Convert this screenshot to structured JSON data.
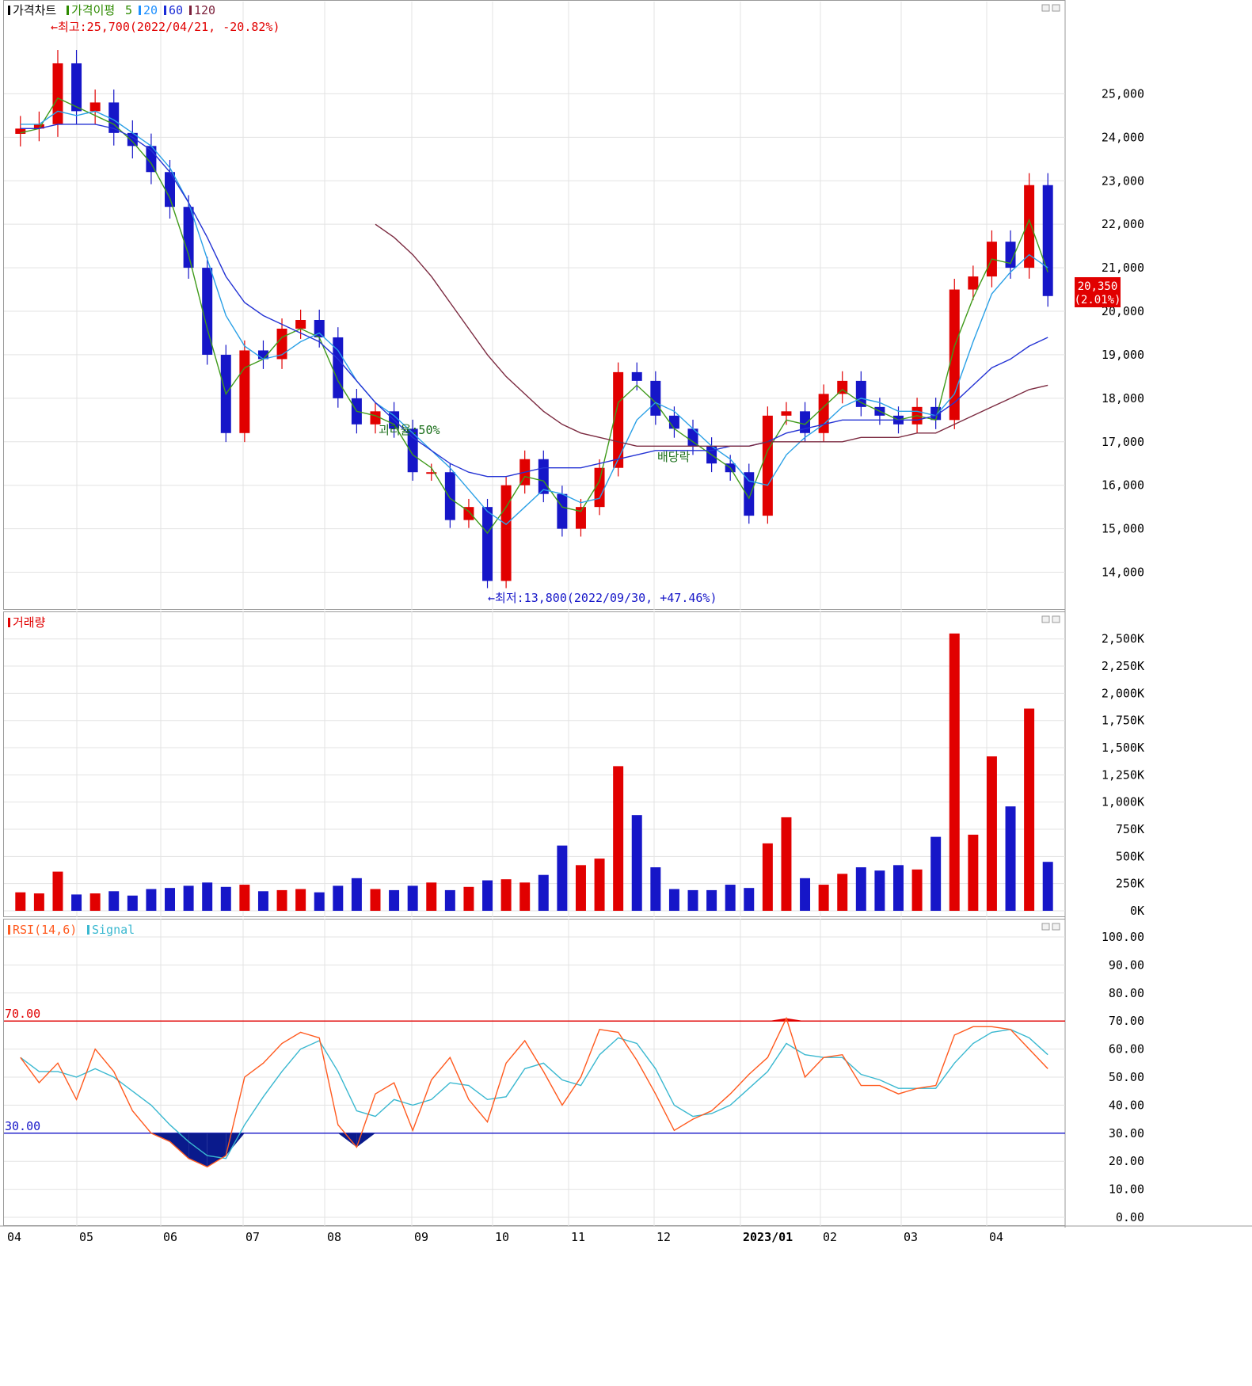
{
  "price_panel": {
    "legend": [
      {
        "text": "가격차트",
        "color": "#000000"
      },
      {
        "text": "가격이평",
        "color": "#2e8b00"
      },
      {
        "text": "5",
        "color": "#2e8b00"
      },
      {
        "text": "20",
        "color": "#1e90ff"
      },
      {
        "text": "60",
        "color": "#1a2bd6"
      },
      {
        "text": "120",
        "color": "#7b1f3a"
      }
    ],
    "high_annotation": "←최고:25,700(2022/04/21, -20.82%)",
    "low_annotation": "←최저:13,800(2022/09/30, +47.46%)",
    "marker_1": "괴리율:50%",
    "marker_2": "배당락",
    "last_price": "20,350",
    "last_change": "(2.01%)",
    "y_ticks": [
      "25,000",
      "24,000",
      "23,000",
      "22,000",
      "21,000",
      "20,000",
      "19,000",
      "18,000",
      "17,000",
      "16,000",
      "15,000",
      "14,000"
    ]
  },
  "volume_panel": {
    "title": "거래량",
    "y_ticks": [
      "2,500K",
      "2,250K",
      "2,000K",
      "1,750K",
      "1,500K",
      "1,250K",
      "1,000K",
      "750K",
      "500K",
      "250K",
      "0K"
    ]
  },
  "rsi_panel": {
    "title": "RSI(14,6)",
    "signal_label": "Signal",
    "level_70": "70.00",
    "level_30": "30.00",
    "y_ticks": [
      "100.00",
      "90.00",
      "80.00",
      "70.00",
      "60.00",
      "50.00",
      "40.00",
      "30.00",
      "20.00",
      "10.00",
      "0.00"
    ]
  },
  "x_axis_labels": [
    "04",
    "05",
    "06",
    "07",
    "08",
    "09",
    "10",
    "11",
    "12",
    "2023/01",
    "02",
    "03",
    "04"
  ],
  "colors": {
    "up": "#e10000",
    "down": "#1616c8",
    "ma5": "#3f9a1a",
    "ma20": "#2aa0e6",
    "ma60": "#2433d4",
    "ma120": "#7b2a40",
    "rsi": "#ff5a1f",
    "signal": "#3ab8d0"
  },
  "chart_data": {
    "type": "line",
    "title": "가격차트",
    "x": [
      "2022/04/08",
      "2022/04/15",
      "2022/04/21",
      "2022/04/29",
      "2022/05/06",
      "2022/05/13",
      "2022/05/20",
      "2022/05/27",
      "2022/06/03",
      "2022/06/10",
      "2022/06/17",
      "2022/06/24",
      "2022/07/01",
      "2022/07/08",
      "2022/07/15",
      "2022/07/22",
      "2022/07/29",
      "2022/08/05",
      "2022/08/12",
      "2022/08/19",
      "2022/08/26",
      "2022/09/02",
      "2022/09/09",
      "2022/09/16",
      "2022/09/23",
      "2022/09/30",
      "2022/10/07",
      "2022/10/14",
      "2022/10/21",
      "2022/10/28",
      "2022/11/04",
      "2022/11/11",
      "2022/11/18",
      "2022/11/25",
      "2022/12/02",
      "2022/12/09",
      "2022/12/16",
      "2022/12/23",
      "2022/12/30",
      "2023/01/06",
      "2023/01/13",
      "2023/01/20",
      "2023/01/27",
      "2023/02/03",
      "2023/02/10",
      "2023/02/17",
      "2023/02/24",
      "2023/03/03",
      "2023/03/10",
      "2023/03/17",
      "2023/03/24",
      "2023/03/31",
      "2023/04/07",
      "2023/04/14",
      "2023/04/21",
      "2023/04/28"
    ],
    "series": [
      {
        "name": "가격차트",
        "values": [
          24200,
          24300,
          25700,
          24600,
          24800,
          24100,
          23800,
          23200,
          22400,
          21000,
          19000,
          17200,
          19100,
          18900,
          19600,
          19800,
          19400,
          18000,
          17400,
          17700,
          17300,
          16300,
          16300,
          15200,
          15500,
          13800,
          16000,
          16600,
          15800,
          15000,
          15500,
          16400,
          18600,
          18400,
          17600,
          17300,
          16900,
          16500,
          16300,
          15300,
          17600,
          17700,
          17200,
          18100,
          18400,
          17800,
          17600,
          17400,
          17800,
          17500,
          20500,
          20800,
          21600,
          21000,
          22900,
          20350
        ]
      },
      {
        "name": "5",
        "values": [
          24100,
          24200,
          24900,
          24700,
          24500,
          24300,
          23900,
          23400,
          22600,
          21300,
          19600,
          18100,
          18700,
          18900,
          19400,
          19600,
          19400,
          18400,
          17700,
          17600,
          17400,
          16700,
          16400,
          15700,
          15400,
          14900,
          15500,
          16200,
          16100,
          15500,
          15400,
          16100,
          17900,
          18300,
          17900,
          17300,
          17000,
          16700,
          16400,
          15700,
          16800,
          17500,
          17400,
          17800,
          18200,
          17900,
          17700,
          17500,
          17600,
          17500,
          19200,
          20300,
          21200,
          21100,
          22100,
          20900
        ]
      },
      {
        "name": "20",
        "values": [
          24300,
          24300,
          24600,
          24500,
          24600,
          24400,
          24100,
          23800,
          23300,
          22500,
          21200,
          19900,
          19200,
          18900,
          19000,
          19300,
          19500,
          19100,
          18400,
          17900,
          17600,
          17200,
          16800,
          16400,
          15900,
          15400,
          15100,
          15500,
          15900,
          15800,
          15600,
          15700,
          16600,
          17500,
          17900,
          17700,
          17300,
          16900,
          16600,
          16100,
          16000,
          16700,
          17100,
          17400,
          17800,
          18000,
          17900,
          17700,
          17700,
          17600,
          18100,
          19300,
          20400,
          20900,
          21300,
          21000
        ]
      },
      {
        "name": "60",
        "values": [
          24200,
          24200,
          24300,
          24300,
          24300,
          24200,
          24000,
          23700,
          23200,
          22500,
          21700,
          20800,
          20200,
          19900,
          19700,
          19500,
          19300,
          18900,
          18400,
          17900,
          17500,
          17100,
          16800,
          16500,
          16300,
          16200,
          16200,
          16300,
          16400,
          16400,
          16400,
          16500,
          16600,
          16700,
          16800,
          16800,
          16800,
          16800,
          16900,
          16900,
          17000,
          17200,
          17300,
          17400,
          17500,
          17500,
          17500,
          17500,
          17500,
          17600,
          17900,
          18300,
          18700,
          18900,
          19200,
          19400
        ]
      },
      {
        "name": "120",
        "values": [
          null,
          null,
          null,
          null,
          null,
          null,
          null,
          null,
          null,
          null,
          null,
          null,
          null,
          null,
          null,
          null,
          null,
          null,
          null,
          22000,
          21700,
          21300,
          20800,
          20200,
          19600,
          19000,
          18500,
          18100,
          17700,
          17400,
          17200,
          17100,
          17000,
          16900,
          16900,
          16900,
          16900,
          16900,
          16900,
          16900,
          17000,
          17000,
          17000,
          17000,
          17000,
          17100,
          17100,
          17100,
          17200,
          17200,
          17400,
          17600,
          17800,
          18000,
          18200,
          18300
        ]
      }
    ],
    "volume_k": [
      170,
      160,
      360,
      150,
      160,
      180,
      140,
      200,
      210,
      230,
      260,
      220,
      240,
      180,
      190,
      200,
      170,
      230,
      300,
      200,
      190,
      230,
      260,
      190,
      220,
      280,
      290,
      260,
      330,
      600,
      420,
      480,
      1330,
      880,
      400,
      200,
      190,
      190,
      240,
      210,
      620,
      860,
      300,
      240,
      340,
      400,
      370,
      420,
      380,
      680,
      2550,
      700,
      1420,
      960,
      1860,
      450
    ],
    "rsi": [
      57,
      48,
      55,
      42,
      60,
      52,
      38,
      30,
      27,
      21,
      18,
      22,
      50,
      55,
      62,
      66,
      64,
      33,
      25,
      44,
      48,
      31,
      49,
      57,
      42,
      34,
      55,
      63,
      52,
      40,
      50,
      67,
      66,
      56,
      44,
      31,
      35,
      38,
      44,
      51,
      57,
      71,
      50,
      57,
      58,
      47,
      47,
      44,
      46,
      47,
      65,
      68,
      68,
      67,
      60,
      53
    ],
    "signal": [
      57,
      52,
      52,
      50,
      53,
      50,
      45,
      40,
      33,
      27,
      22,
      21,
      33,
      43,
      52,
      60,
      63,
      52,
      38,
      36,
      42,
      40,
      42,
      48,
      47,
      42,
      43,
      53,
      55,
      49,
      47,
      58,
      64,
      62,
      53,
      40,
      36,
      37,
      40,
      46,
      52,
      62,
      58,
      57,
      57,
      51,
      49,
      46,
      46,
      46,
      55,
      62,
      66,
      67,
      64,
      58
    ],
    "ylim": [
      13500,
      26100
    ],
    "volume_ylim": [
      0,
      2600
    ],
    "rsi_ylim": [
      0,
      100
    ]
  }
}
